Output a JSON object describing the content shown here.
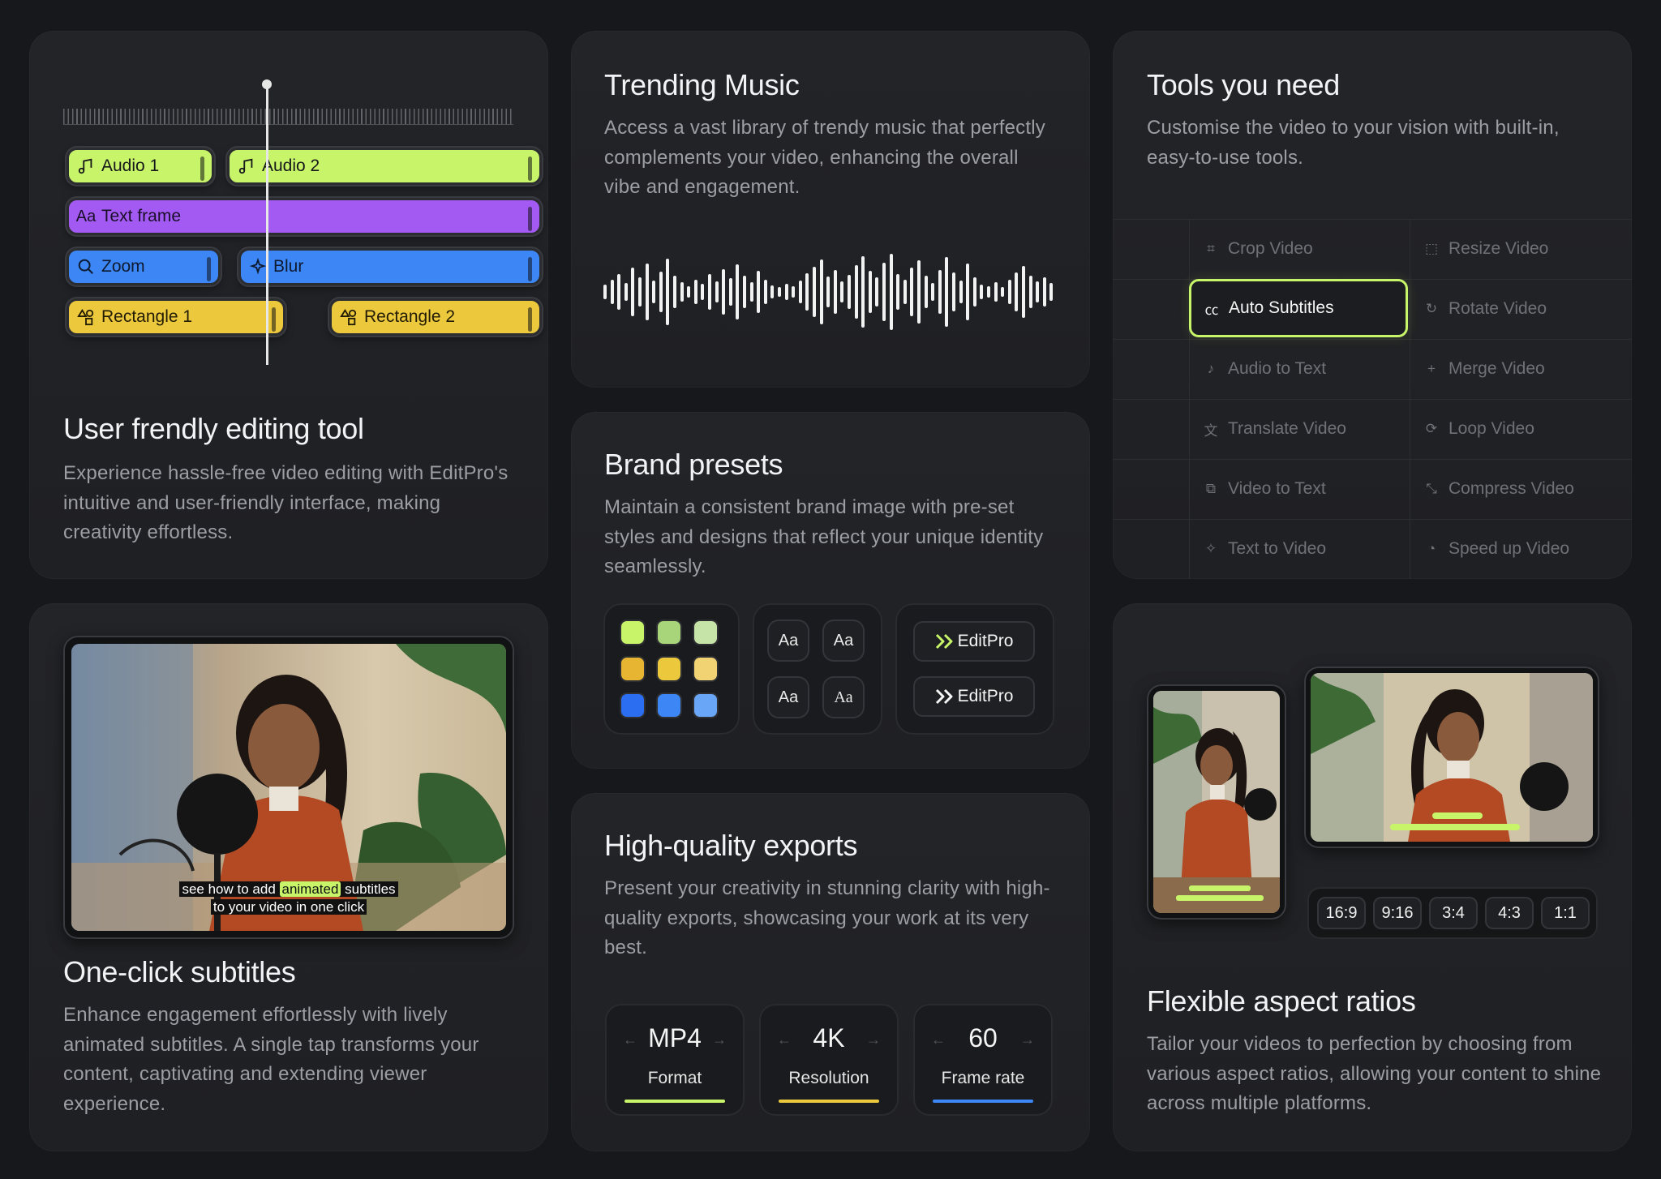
{
  "editing": {
    "title": "User frendly editing tool",
    "description": "Experience hassle-free video editing with EditPro's intuitive and user-friendly interface, making creativity effortless.",
    "tracks": {
      "audio1": "Audio 1",
      "audio2": "Audio 2",
      "text_frame": "Text frame",
      "zoom": "Zoom",
      "blur": "Blur",
      "rect1": "Rectangle 1",
      "rect2": "Rectangle 2"
    }
  },
  "music": {
    "title": "Trending Music",
    "description": "Access a vast library of trendy music that perfectly complements your video, enhancing the overall vibe and engagement."
  },
  "tools": {
    "title": "Tools you need",
    "description": "Customise the video to your vision with built-in, easy-to-use tools.",
    "items": [
      {
        "label": "Crop Video",
        "icon": "crop-icon",
        "glyph": "⌗"
      },
      {
        "label": "Resize Video",
        "icon": "resize-icon",
        "glyph": "⬚"
      },
      {
        "label": "Auto Subtitles",
        "icon": "cc-icon",
        "glyph": "㏄"
      },
      {
        "label": "Rotate Video",
        "icon": "rotate-icon",
        "glyph": "↻"
      },
      {
        "label": "Audio to Text",
        "icon": "music-note-icon",
        "glyph": "♪"
      },
      {
        "label": "Merge Video",
        "icon": "plus-icon",
        "glyph": "+"
      },
      {
        "label": "Translate Video",
        "icon": "translate-icon",
        "glyph": "文"
      },
      {
        "label": "Loop Video",
        "icon": "loop-icon",
        "glyph": "⟳"
      },
      {
        "label": "Video to Text",
        "icon": "video-text-icon",
        "glyph": "⧉"
      },
      {
        "label": "Compress Video",
        "icon": "compress-icon",
        "glyph": "⤡"
      },
      {
        "label": "Text to Video",
        "icon": "magic-icon",
        "glyph": "✧"
      },
      {
        "label": "Speed up Video",
        "icon": "speedometer-icon",
        "glyph": "◔"
      }
    ]
  },
  "brand": {
    "title": "Brand presets",
    "description": "Maintain a consistent brand image with pre-set styles and designs that reflect your unique identity seamlessly.",
    "swatches": [
      "#c8f46a",
      "#a8d47a",
      "#c6e3a8",
      "#e7b531",
      "#ecc83c",
      "#f1d373",
      "#2c6ef2",
      "#3d86f5",
      "#6aa6f8"
    ],
    "font_sample": "Aa",
    "logo_text": "EditPro"
  },
  "subtitles": {
    "title": "One-click subtitles",
    "description": "Enhance engagement effortlessly with lively animated subtitles. A single tap transforms your content, captivating and extending viewer experience.",
    "caption_line1_pre": "see how to add ",
    "caption_highlight": "animated",
    "caption_line1_post": " subtitles",
    "caption_line2": "to your video in one click"
  },
  "exports": {
    "title": "High-quality exports",
    "description": "Present your creativity in stunning clarity with high-quality exports, showcasing your work at its very best.",
    "items": [
      {
        "value": "MP4",
        "label": "Format",
        "color": "#c8f46a"
      },
      {
        "value": "4K",
        "label": "Resolution",
        "color": "#ecc83c"
      },
      {
        "value": "60",
        "label": "Frame rate",
        "color": "#3d86f5"
      }
    ]
  },
  "aspect": {
    "title": "Flexible aspect ratios",
    "description": "Tailor your videos to perfection by choosing from various aspect ratios, allowing your content to shine across multiple platforms.",
    "ratios": [
      "16:9",
      "9:16",
      "3:4",
      "4:3",
      "1:1"
    ]
  },
  "colors": {
    "background": "#17181b",
    "accent_green": "#c8f46a",
    "accent_purple": "#a35af2",
    "accent_blue": "#3d86f5",
    "accent_yellow": "#ecc83c"
  }
}
